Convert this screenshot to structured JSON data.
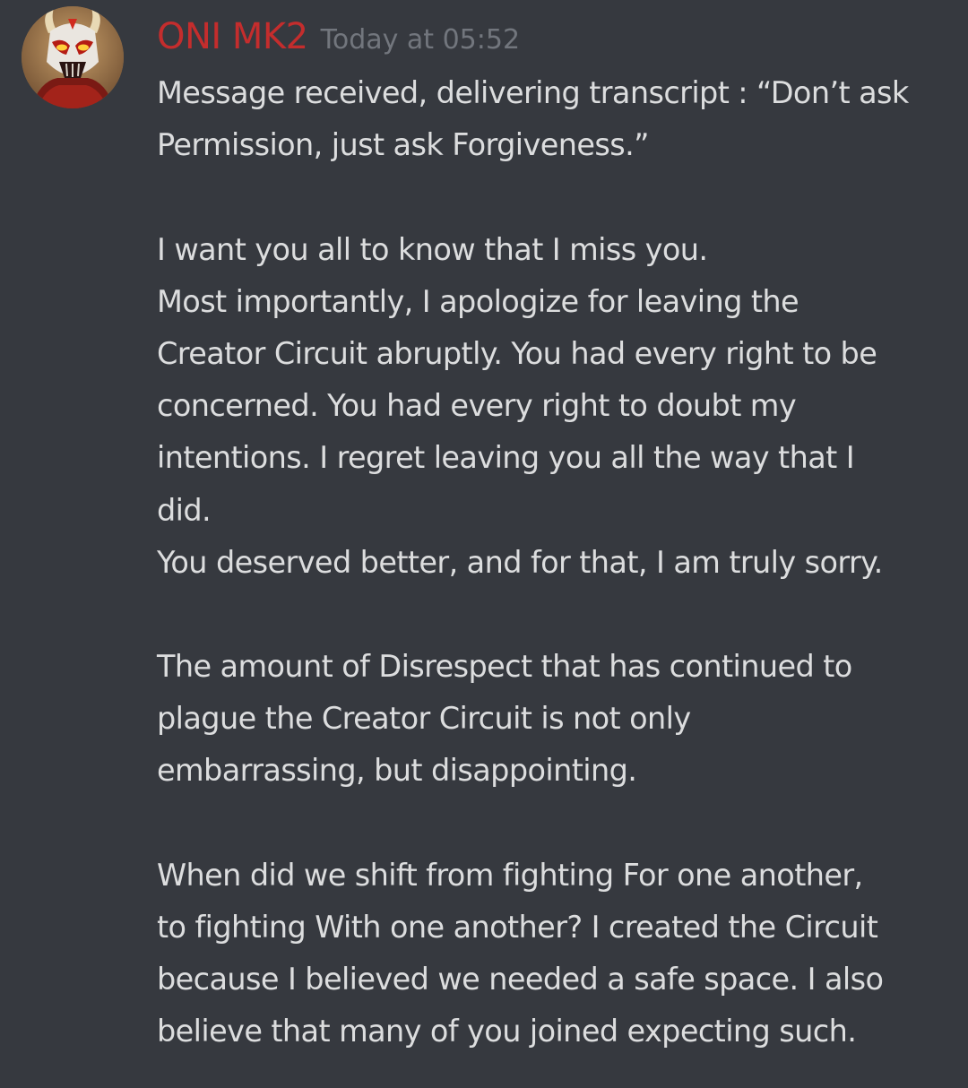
{
  "message": {
    "author": {
      "name": "ONI MK2",
      "name_color": "#c42d2d",
      "avatar_icon": "oni-mask-avatar"
    },
    "timestamp": "Today at 05:52",
    "lines": [
      "Message received, delivering transcript : “Don’t ask",
      "Permission, just ask Forgiveness.”",
      "",
      "I want you all to know that I miss you.",
      "Most importantly, I apologize for leaving the",
      "Creator Circuit abruptly. You had every right to be",
      "concerned. You had every right to doubt my",
      "intentions. I regret leaving you all the way that I",
      "did.",
      "You deserved better, and for that, I am truly sorry.",
      "",
      "The amount of Disrespect that has continued to",
      "plague the Creator Circuit is not only",
      "embarrassing, but disappointing.",
      "",
      "When did we shift from fighting For one another,",
      "to fighting With one another? I created the Circuit",
      "because I believed we needed a safe space. I also",
      "believe that many of you joined expecting such."
    ]
  },
  "theme": {
    "background": "#36393f",
    "text": "#dcddde",
    "timestamp": "#72767d"
  }
}
